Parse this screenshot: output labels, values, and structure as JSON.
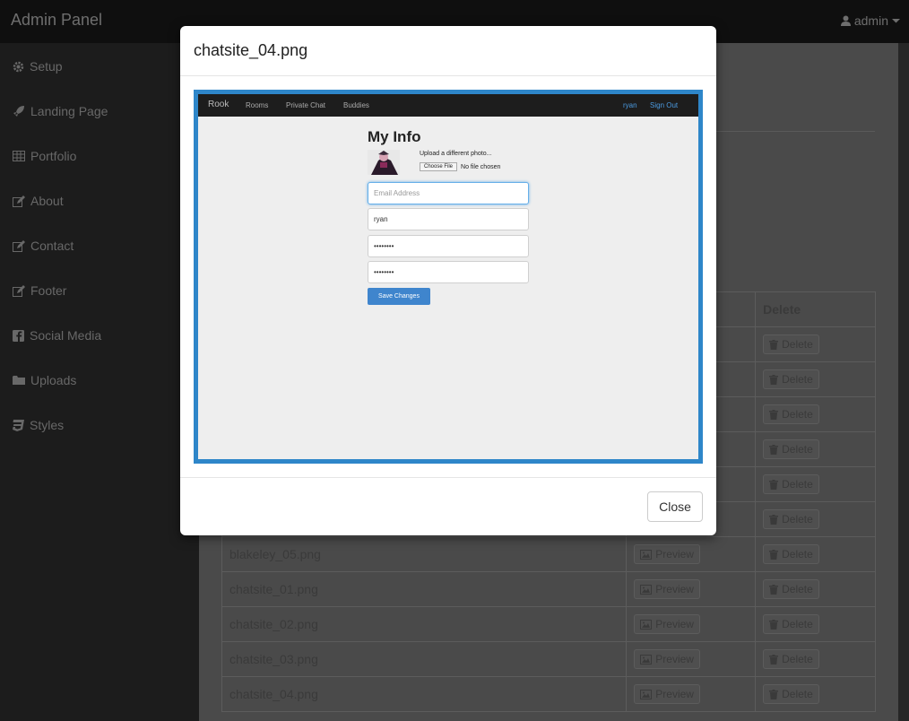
{
  "app": {
    "brand": "Admin Panel",
    "user": "admin"
  },
  "sidebar": {
    "items": [
      {
        "label": "Setup",
        "icon": "gear-icon"
      },
      {
        "label": "Landing Page",
        "icon": "rocket-icon"
      },
      {
        "label": "Portfolio",
        "icon": "grid-icon"
      },
      {
        "label": "About",
        "icon": "edit-icon"
      },
      {
        "label": "Contact",
        "icon": "edit-icon"
      },
      {
        "label": "Footer",
        "icon": "edit-icon"
      },
      {
        "label": "Social Media",
        "icon": "facebook-icon"
      },
      {
        "label": "Uploads",
        "icon": "folder-icon"
      },
      {
        "label": "Styles",
        "icon": "css3-icon"
      }
    ]
  },
  "table": {
    "header_delete": "Delete",
    "preview_label": "Preview",
    "delete_label": "Delete",
    "rows": [
      "",
      "",
      "",
      "",
      "",
      "",
      "blakeley_05.png",
      "chatsite_01.png",
      "chatsite_02.png",
      "chatsite_03.png",
      "chatsite_04.png"
    ]
  },
  "modal": {
    "title": "chatsite_04.png",
    "close_label": "Close"
  },
  "preview": {
    "brand": "Rook",
    "nav": [
      "Rooms",
      "Private Chat",
      "Buddies"
    ],
    "user_link": "ryan",
    "signout_link": "Sign Out",
    "heading": "My Info",
    "upload_text": "Upload a different photo...",
    "choose_file": "Choose File",
    "no_file": "No file chosen",
    "email_placeholder": "Email Address",
    "username_value": "ryan",
    "password_value": "••••••••",
    "password_confirm_value": "••••••••",
    "save_label": "Save Changes"
  }
}
